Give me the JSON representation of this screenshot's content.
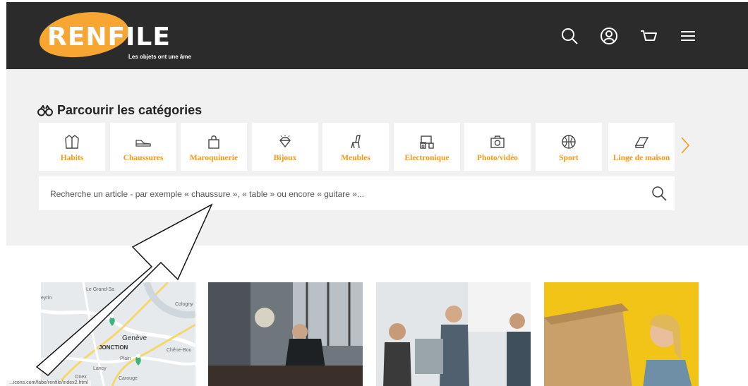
{
  "header": {
    "logo_text": "RENFILE",
    "tagline": "Les objets ont une âme",
    "icons": [
      "search-icon",
      "user-icon",
      "cart-icon",
      "menu-icon"
    ]
  },
  "browse": {
    "title": "Parcourir les catégories",
    "categories": [
      {
        "label": "Habits",
        "icon": "jacket-icon"
      },
      {
        "label": "Chaussures",
        "icon": "shoe-icon"
      },
      {
        "label": "Maroquinerie",
        "icon": "bag-icon"
      },
      {
        "label": "Bijoux",
        "icon": "diamond-icon"
      },
      {
        "label": "Meubles",
        "icon": "chair-icon"
      },
      {
        "label": "Electronique",
        "icon": "devices-icon"
      },
      {
        "label": "Photo/vidéo",
        "icon": "camera-icon"
      },
      {
        "label": "Sport",
        "icon": "basketball-icon"
      },
      {
        "label": "Linge de maison",
        "icon": "towel-icon"
      }
    ],
    "search_placeholder": "Recherche un article - par exemple « chaussure », « table » ou encore « guitare »..."
  },
  "map": {
    "labels": [
      "Le Grand-Sa",
      "eyrin",
      "Cologny",
      "Genève",
      "JONCTION",
      "Chêne-Bou",
      "Plain",
      "Lancy",
      "Onex",
      "Carouge"
    ]
  },
  "status_text": "...icons.com/fabe/renfile/index2.html",
  "colors": {
    "header_bg": "#2b2b2b",
    "accent": "#f39a1f",
    "panel_bg": "#f1f1f1"
  }
}
